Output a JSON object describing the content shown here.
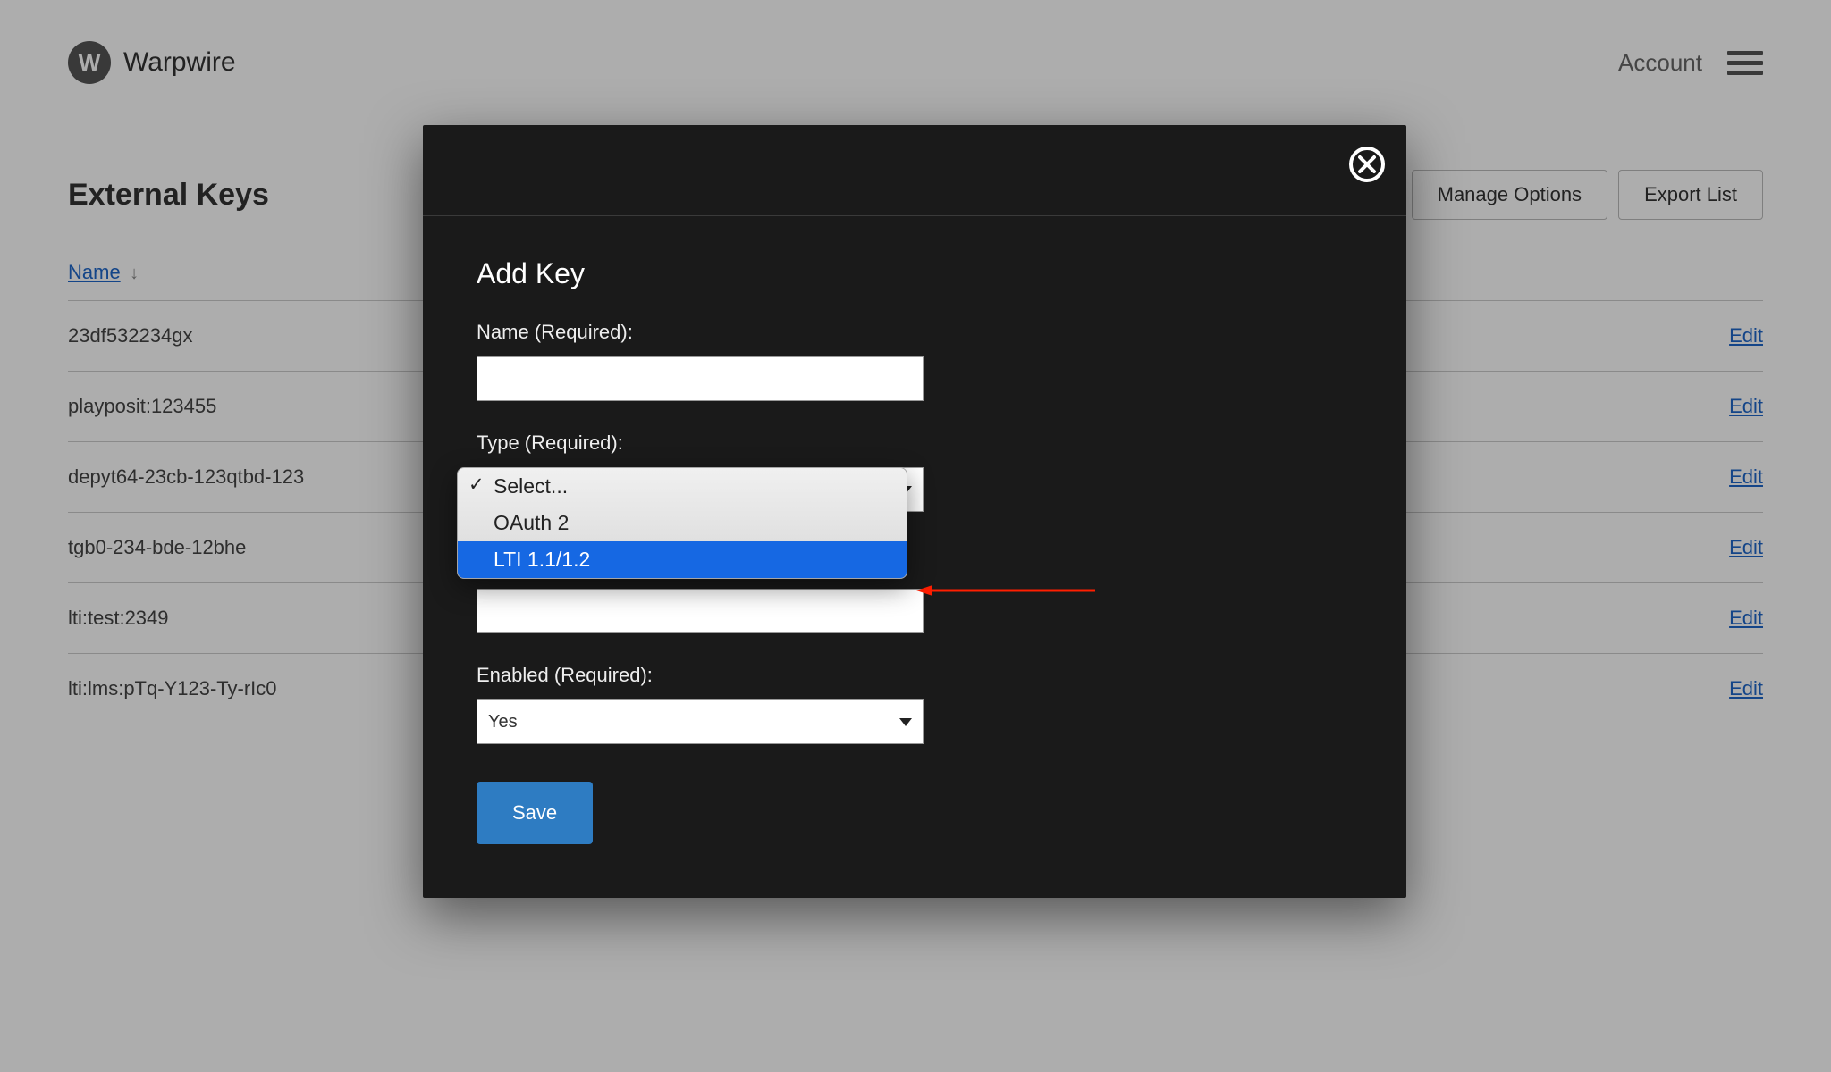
{
  "brand": {
    "logo_letter": "W",
    "name": "Warpwire"
  },
  "topbar": {
    "account_label": "Account"
  },
  "page": {
    "title": "External Keys",
    "manage_options_btn": "Manage Options",
    "export_list_btn": "Export List",
    "sort_column_label": "Name",
    "sort_arrow_glyph": "↓",
    "edit_label": "Edit",
    "rows": [
      {
        "name": "23df532234gx"
      },
      {
        "name": "playposit:123455"
      },
      {
        "name": "depyt64-23cb-123qtbd-123"
      },
      {
        "name": "tgb0-234-bde-12bhe"
      },
      {
        "name": "lti:test:2349"
      },
      {
        "name": "lti:lms:pTq-Y123-Ty-rIc0"
      }
    ]
  },
  "modal": {
    "title": "Add Key",
    "name_label": "Name (Required):",
    "name_value": "",
    "type_label": "Type (Required):",
    "type_options": {
      "placeholder": "Select...",
      "oauth2": "OAuth 2",
      "lti": "LTI 1.1/1.2"
    },
    "hidden_field_value": "",
    "enabled_label": "Enabled (Required):",
    "enabled_value": "Yes",
    "save_label": "Save"
  }
}
